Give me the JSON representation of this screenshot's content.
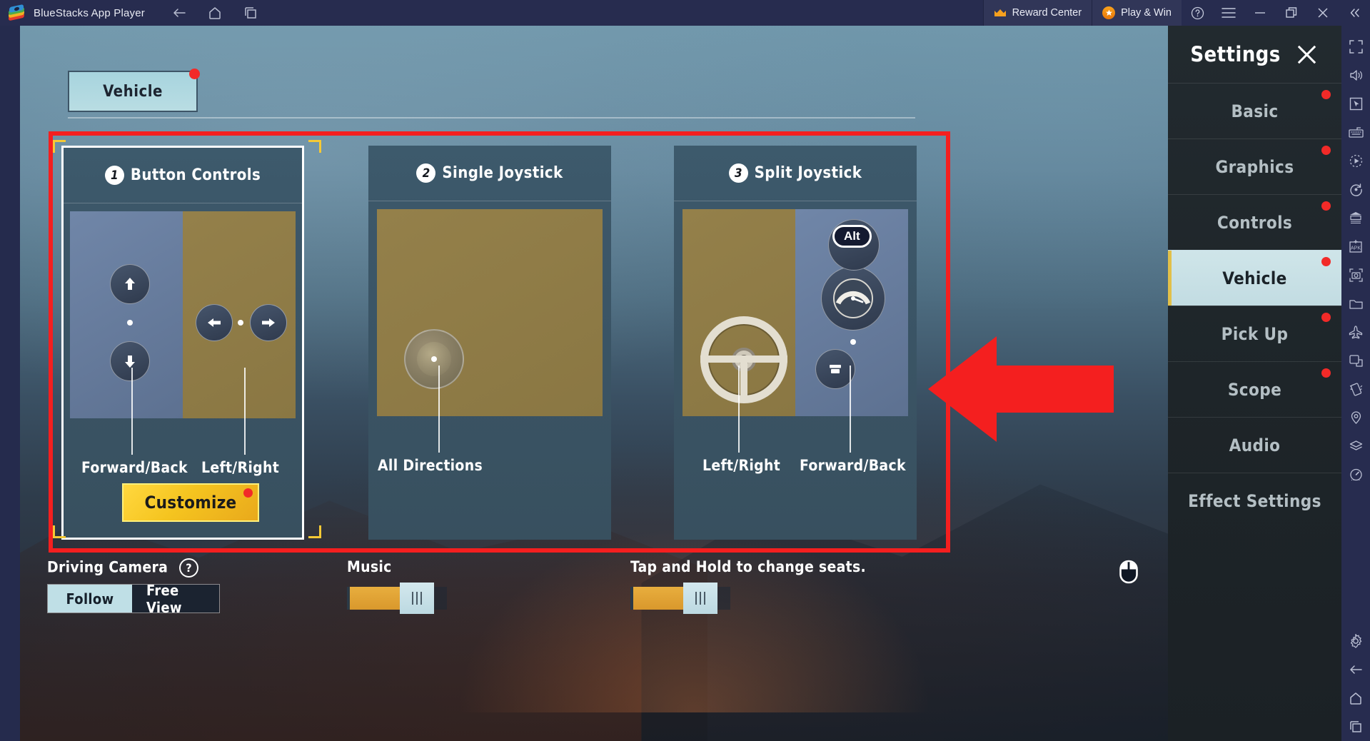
{
  "titlebar": {
    "app_title": "BlueStacks App Player",
    "nav": [
      {
        "name": "back-icon",
        "label": "Back"
      },
      {
        "name": "home-icon",
        "label": "Home"
      },
      {
        "name": "recent-apps-icon",
        "label": "Recent Apps"
      }
    ],
    "reward_center": "Reward Center",
    "play_and_win": "Play & Win",
    "buttons": [
      {
        "name": "help-icon",
        "label": "Help"
      },
      {
        "name": "menu-icon",
        "label": "Menu"
      },
      {
        "name": "minimize-icon",
        "label": "Minimize"
      },
      {
        "name": "maximize-icon",
        "label": "Maximize"
      },
      {
        "name": "close-icon",
        "label": "Close"
      },
      {
        "name": "collapse-sidebar-icon",
        "label": "Collapse"
      }
    ]
  },
  "sidebar": {
    "items": [
      {
        "name": "fullscreen-icon",
        "label": "Fullscreen"
      },
      {
        "name": "volume-icon",
        "label": "Volume"
      },
      {
        "name": "cursor-icon",
        "label": "Game controls"
      },
      {
        "name": "keyboard-icon",
        "label": "Keyboard controls"
      },
      {
        "name": "macro-icon",
        "label": "Macro recorder"
      },
      {
        "name": "rotate-icon",
        "label": "Rotate"
      },
      {
        "name": "multi-instance-icon",
        "label": "Multi-instance manager"
      },
      {
        "name": "install-apk-icon",
        "label": "Install APK"
      },
      {
        "name": "screenshot-icon",
        "label": "Screenshot"
      },
      {
        "name": "media-folder-icon",
        "label": "Media manager"
      },
      {
        "name": "eco-mode-icon",
        "label": "Eco mode"
      },
      {
        "name": "real-time-translation-icon",
        "label": "Real-time translation"
      },
      {
        "name": "shake-icon",
        "label": "Shake"
      },
      {
        "name": "location-icon",
        "label": "Location"
      },
      {
        "name": "layers-icon",
        "label": "Layers"
      },
      {
        "name": "performance-icon",
        "label": "Performance"
      },
      {
        "name": "settings-gear-icon",
        "label": "Settings"
      },
      {
        "name": "back-icon",
        "label": "Back"
      },
      {
        "name": "home-icon",
        "label": "Home"
      },
      {
        "name": "recent-apps-icon",
        "label": "Recent apps"
      }
    ]
  },
  "game": {
    "top_tab": "Vehicle",
    "cards": [
      {
        "number": "1",
        "title": "Button Controls",
        "left_label": "Forward/Back",
        "right_label": "Left/Right",
        "selected": true,
        "customize_label": "Customize"
      },
      {
        "number": "2",
        "title": "Single Joystick",
        "center_label": "All Directions",
        "selected": false
      },
      {
        "number": "3",
        "title": "Split Joystick",
        "left_label": "Left/Right",
        "right_label": "Forward/Back",
        "key_hint": "Alt",
        "selected": false
      }
    ],
    "bottom": {
      "driving_camera_label": "Driving Camera",
      "driving_camera_help": "?",
      "camera_options": [
        {
          "label": "Follow",
          "selected": true
        },
        {
          "label": "Free View",
          "selected": false
        }
      ],
      "music_label": "Music",
      "music_value": 56,
      "seats_label": "Tap and Hold to change seats.",
      "seats_value": 56
    }
  },
  "settings": {
    "title": "Settings",
    "close_label": "Close settings",
    "items": [
      {
        "label": "Basic",
        "active": false,
        "dot": true
      },
      {
        "label": "Graphics",
        "active": false,
        "dot": true
      },
      {
        "label": "Controls",
        "active": false,
        "dot": true
      },
      {
        "label": "Vehicle",
        "active": true,
        "dot": true
      },
      {
        "label": "Pick Up",
        "active": false,
        "dot": true
      },
      {
        "label": "Scope",
        "active": false,
        "dot": true
      },
      {
        "label": "Audio",
        "active": false,
        "dot": false
      },
      {
        "label": "Effect Settings",
        "active": false,
        "dot": false
      }
    ]
  },
  "colors": {
    "accent_red": "#f41f1f",
    "brand_dark": "#272c4f",
    "highlight": "#c2dce2",
    "customize_gold": "#f5c41f"
  }
}
